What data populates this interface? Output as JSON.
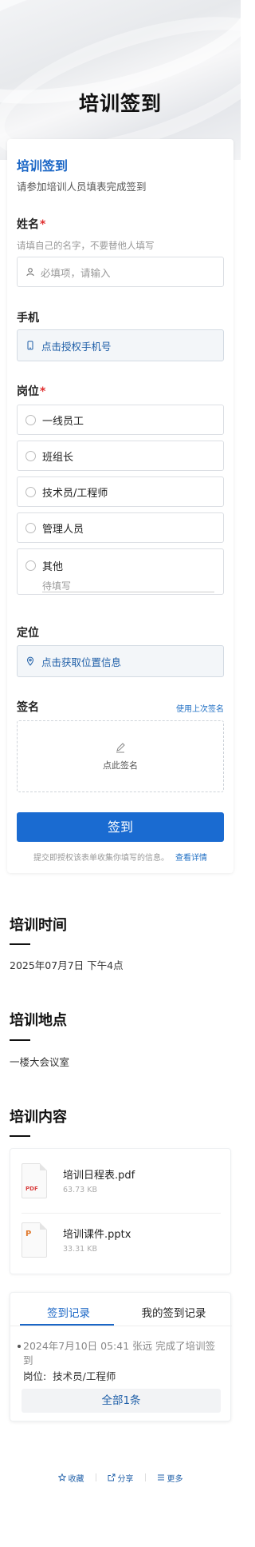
{
  "page": {
    "title": "培训签到"
  },
  "form": {
    "title": "培训签到",
    "description": "请参加培训人员填表完成签到",
    "name_field": {
      "label": "姓名",
      "required_mark": "*",
      "hint": "请填自己的名字，不要替他人填写",
      "placeholder": "必填项，请输入",
      "icon": "user-icon"
    },
    "phone_field": {
      "label": "手机",
      "action": "点击授权手机号",
      "icon": "phone-icon"
    },
    "position_field": {
      "label": "岗位",
      "required_mark": "*",
      "options": [
        "一线员工",
        "班组长",
        "技术员/工程师",
        "管理人员",
        "其他"
      ],
      "other_placeholder": "待填写"
    },
    "location_field": {
      "label": "定位",
      "action": "点击获取位置信息",
      "icon": "location-pin-icon"
    },
    "signature_field": {
      "label": "签名",
      "use_last": "使用上次签名",
      "area_text": "点此签名",
      "icon": "pen-icon"
    },
    "submit_label": "签到",
    "consent_text": "提交即授权该表单收集你填写的信息。",
    "consent_link": "查看详情"
  },
  "sections": {
    "time": {
      "title": "培训时间",
      "value": "2025年07月7日 下午4点"
    },
    "location": {
      "title": "培训地点",
      "value": "一楼大会议室"
    },
    "content": {
      "title": "培训内容",
      "files": [
        {
          "name": "培训日程表.pdf",
          "size": "63.73 KB",
          "type": "PDF"
        },
        {
          "name": "培训课件.pptx",
          "size": "33.31 KB",
          "type": "P"
        }
      ]
    }
  },
  "records": {
    "tabs": [
      "签到记录",
      "我的签到记录"
    ],
    "items": [
      {
        "text": "2024年7月10日 05:41 张远 完成了培训签到",
        "meta_label": "岗位:",
        "meta_value": "技术员/工程师"
      }
    ],
    "all_label": "全部1条"
  },
  "footer": {
    "items": [
      {
        "label": "收藏",
        "icon": "star-icon"
      },
      {
        "label": "分享",
        "icon": "share-icon"
      },
      {
        "label": "更多",
        "icon": "menu-icon"
      }
    ]
  },
  "colors": {
    "accent": "#1a6bd1",
    "required": "#e02e2e",
    "link": "#1f6fc4"
  }
}
